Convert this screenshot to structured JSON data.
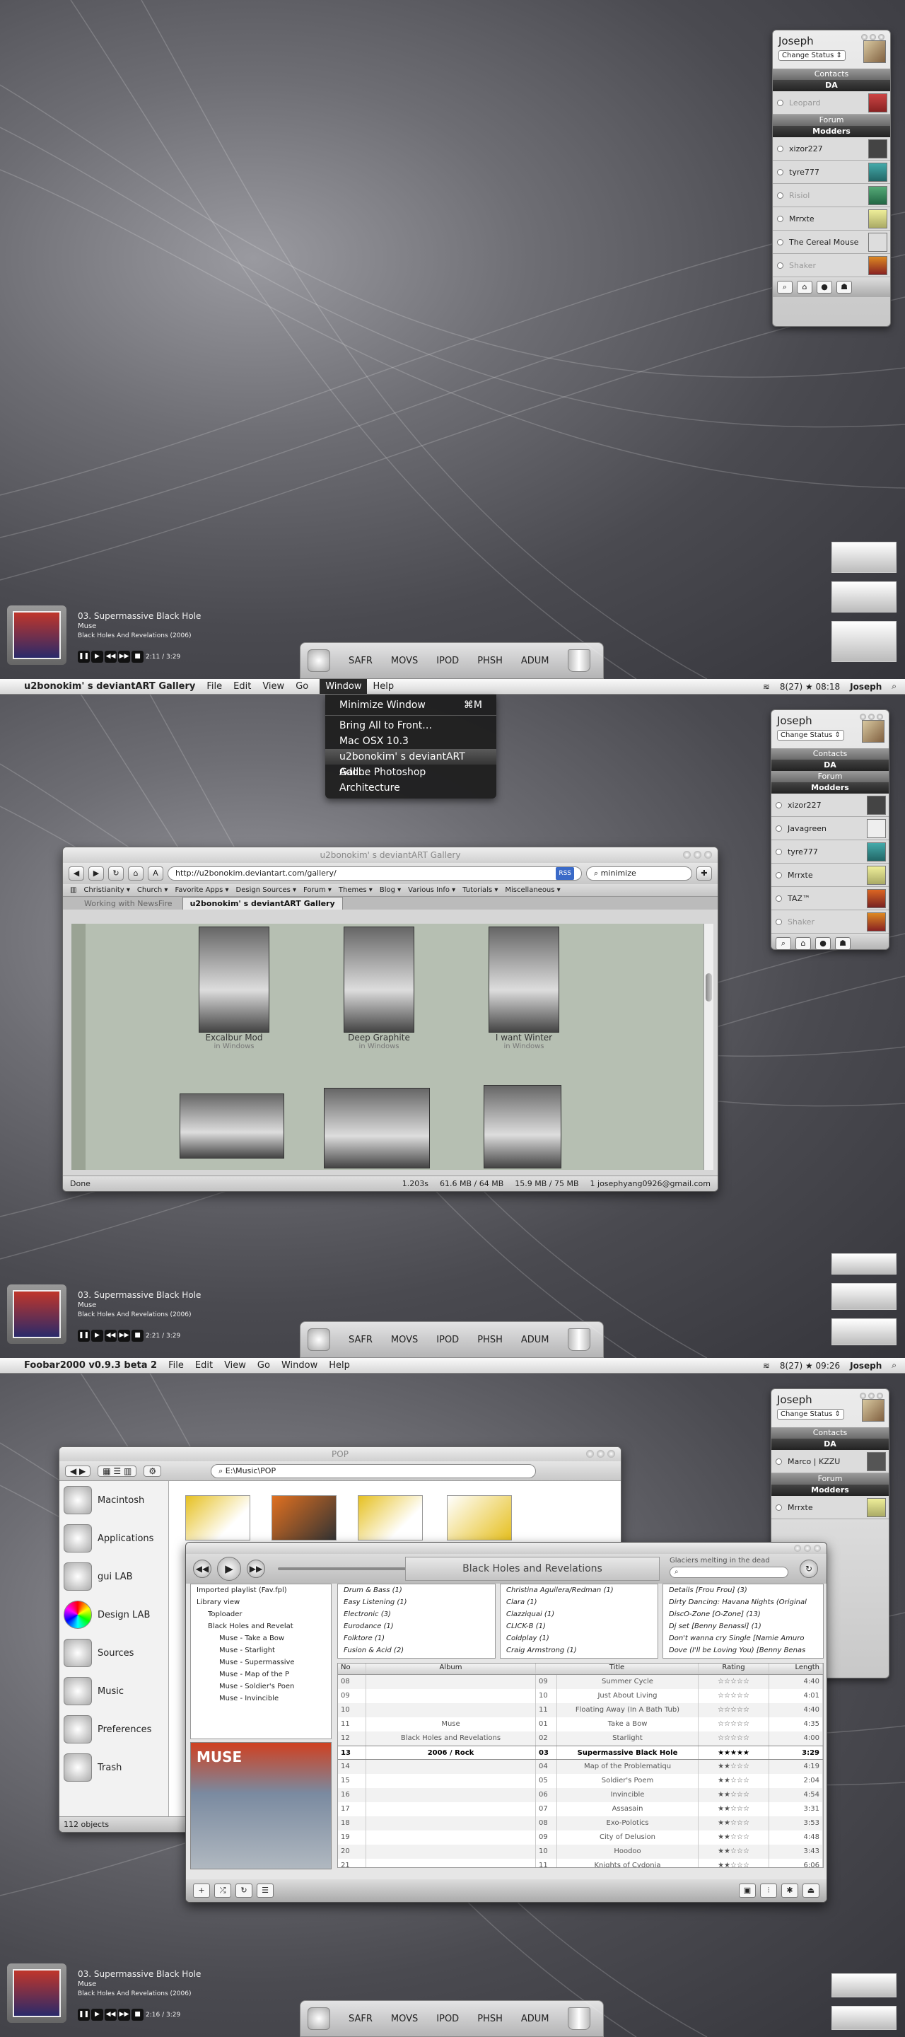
{
  "screen1": {
    "buddy": {
      "user": "Joseph",
      "status": "Change Status",
      "groups": [
        "Contacts",
        "DA",
        "Forum",
        "Modders"
      ],
      "da_contacts": [
        "Leopard"
      ],
      "modders": [
        {
          "name": "xizor227",
          "away": false
        },
        {
          "name": "tyre777",
          "away": false
        },
        {
          "name": "Risiol",
          "away": true
        },
        {
          "name": "Mrrxte",
          "away": false
        },
        {
          "name": "The Cereal Mouse",
          "away": false
        },
        {
          "name": "Shaker",
          "away": true
        }
      ]
    },
    "nowplaying": {
      "title": "03. Supermassive Black Hole",
      "artist": "Muse",
      "album": "Black Holes And Revelations (2006)",
      "time": "2:11 / 3:29"
    },
    "dock": [
      "SAFR",
      "MOVS",
      "IPOD",
      "PHSH",
      "ADUM"
    ]
  },
  "screen2": {
    "menubar": {
      "app": "u2bonokim' s deviantART Gallery",
      "items": [
        "File",
        "Edit",
        "View",
        "Go",
        "Window",
        "Help"
      ],
      "status": "8(27) ★ 08:18",
      "user": "Joseph"
    },
    "window_menu": {
      "items": [
        {
          "label": "Minimize Window",
          "shortcut": "⌘M"
        },
        {
          "label": "Bring All to Front…",
          "shortcut": ""
        },
        {
          "label": "Mac OSX 10.3",
          "shortcut": ""
        },
        {
          "label": "u2bonokim' s deviantART Gall...",
          "shortcut": ""
        },
        {
          "label": "Adobe Photoshop",
          "shortcut": ""
        },
        {
          "label": "Architecture",
          "shortcut": ""
        }
      ]
    },
    "buddy": {
      "user": "Joseph",
      "status": "Change Status",
      "groups": [
        "Contacts",
        "DA",
        "Forum",
        "Modders"
      ],
      "modders": [
        {
          "name": "xizor227",
          "away": false
        },
        {
          "name": "Javagreen",
          "away": false
        },
        {
          "name": "tyre777",
          "away": false
        },
        {
          "name": "Mrrxte",
          "away": false
        },
        {
          "name": "TAZ™",
          "away": false
        },
        {
          "name": "Shaker",
          "away": true
        }
      ]
    },
    "browser": {
      "title": "u2bonokim' s deviantART Gallery",
      "url": "http://u2bonokim.deviantart.com/gallery/",
      "rss": "RSS",
      "search": "minimize",
      "bookmarks": [
        "Christianity ▾",
        "Church ▾",
        "Favorite Apps ▾",
        "Design Sources ▾",
        "Forum ▾",
        "Themes ▾",
        "Blog ▾",
        "Various Info ▾",
        "Tutorials ▾",
        "Miscellaneous ▾"
      ],
      "tabs": [
        "Working with NewsFire",
        "u2bonokim' s deviantART Gallery"
      ],
      "gallery": [
        {
          "title": "Excalbur Mod",
          "sub": "in Windows"
        },
        {
          "title": "Deep Graphite",
          "sub": "in Windows"
        },
        {
          "title": "I want Winter",
          "sub": "in Windows"
        }
      ],
      "status_left": "Done",
      "status_items": [
        "1.203s",
        "61.6 MB / 64 MB",
        "15.9 MB / 75 MB",
        "1 josephyang0926@gmail.com"
      ]
    },
    "nowplaying": {
      "title": "03. Supermassive Black Hole",
      "artist": "Muse",
      "album": "Black Holes And Revelations (2006)",
      "time": "2:21 / 3:29"
    },
    "dock": [
      "SAFR",
      "MOVS",
      "IPOD",
      "PHSH",
      "ADUM"
    ]
  },
  "screen3": {
    "menubar": {
      "app": "Foobar2000 v0.9.3 beta 2",
      "items": [
        "File",
        "Edit",
        "View",
        "Go",
        "Window",
        "Help"
      ],
      "status": "8(27) ★ 09:26",
      "user": "Joseph"
    },
    "buddy": {
      "user": "Joseph",
      "status": "Change Status",
      "groups": [
        "Contacts",
        "DA",
        "Forum",
        "Modders"
      ],
      "da_contacts": [
        "Marco | KZZU"
      ],
      "modders": [
        {
          "name": "Mrrxte",
          "away": false
        }
      ]
    },
    "finder": {
      "title": "POP",
      "path": "E:\\Music\\POP",
      "sidebar": [
        "Macintosh",
        "Applications",
        "gui LAB",
        "Design LAB",
        "Sources",
        "Music",
        "Preferences",
        "Trash"
      ],
      "footer": "112 objects"
    },
    "foobar": {
      "display": "Black Holes and Revelations",
      "search_label": "Glaciers melting in the dead",
      "tree": [
        "Imported playlist (Fav.fpl)",
        "Library view",
        "Toploader",
        "Black Holes and Revelat",
        "Muse - Take a Bow",
        "Muse - Starlight",
        "Muse - Supermassive",
        "Muse - Map of the P",
        "Muse - Soldier's Poen",
        "Muse - Invincible"
      ],
      "genres": [
        "Drum & Bass (1)",
        "Easy Listening (1)",
        "Electronic (3)",
        "Eurodance (1)",
        "Folktore (1)",
        "Fusion & Acid (2)"
      ],
      "artists": [
        "Christina Aguilera/Redman (1)",
        "Clara (1)",
        "Clazziquai (1)",
        "CLICK-B (1)",
        "Coldplay (1)",
        "Craig Armstrong (1)"
      ],
      "albums": [
        "Details [Frou Frou] (3)",
        "Dirty Dancing: Havana Nights (Original",
        "DiscO-Zone [O-Zone] (13)",
        "Dj set [Benny Benassi] (1)",
        "Don't wanna cry Single [Namie Amuro",
        "Dove (I'll be Loving You) [Benny Benas"
      ],
      "columns": [
        "No",
        "Album",
        "Title",
        "Rating",
        "Length"
      ],
      "album_info": [
        "Muse",
        "Black Holes and Revelations",
        "2006 / Rock"
      ],
      "cover_text": "MUSE",
      "rows": [
        {
          "no": "08",
          "track": "09",
          "title": "Summer Cycle",
          "stars": "☆☆☆☆☆",
          "len": "4:40"
        },
        {
          "no": "09",
          "track": "10",
          "title": "Just About Living",
          "stars": "☆☆☆☆☆",
          "len": "4:01"
        },
        {
          "no": "10",
          "track": "11",
          "title": "Floating Away (In A Bath Tub)",
          "stars": "☆☆☆☆☆",
          "len": "4:40"
        },
        {
          "no": "11",
          "track": "01",
          "title": "Take a Bow",
          "stars": "☆☆☆☆☆",
          "len": "4:35"
        },
        {
          "no": "12",
          "track": "02",
          "title": "Starlight",
          "stars": "☆☆☆☆☆",
          "len": "4:00"
        },
        {
          "no": "13",
          "track": "03",
          "title": "Supermassive Black Hole",
          "stars": "★★★★★",
          "len": "3:29"
        },
        {
          "no": "14",
          "track": "04",
          "title": "Map of the Problematiqu",
          "stars": "★★☆☆☆",
          "len": "4:19"
        },
        {
          "no": "15",
          "track": "05",
          "title": "Soldier's Poem",
          "stars": "★★☆☆☆",
          "len": "2:04"
        },
        {
          "no": "16",
          "track": "06",
          "title": "Invincible",
          "stars": "★★☆☆☆",
          "len": "4:54"
        },
        {
          "no": "17",
          "track": "07",
          "title": "Assasain",
          "stars": "★★☆☆☆",
          "len": "3:31"
        },
        {
          "no": "18",
          "track": "08",
          "title": "Exo-Polotics",
          "stars": "★★☆☆☆",
          "len": "3:53"
        },
        {
          "no": "19",
          "track": "09",
          "title": "City of Delusion",
          "stars": "★★☆☆☆",
          "len": "4:48"
        },
        {
          "no": "20",
          "track": "10",
          "title": "Hoodoo",
          "stars": "★★☆☆☆",
          "len": "3:43"
        },
        {
          "no": "21",
          "track": "11",
          "title": "Knights of Cydonia",
          "stars": "★★☆☆☆",
          "len": "6:06"
        }
      ]
    },
    "nowplaying": {
      "title": "03. Supermassive Black Hole",
      "artist": "Muse",
      "album": "Black Holes And Revelations (2006)",
      "time": "2:16 / 3:29"
    },
    "dock": [
      "SAFR",
      "MOVS",
      "IPOD",
      "PHSH",
      "ADUM"
    ]
  }
}
